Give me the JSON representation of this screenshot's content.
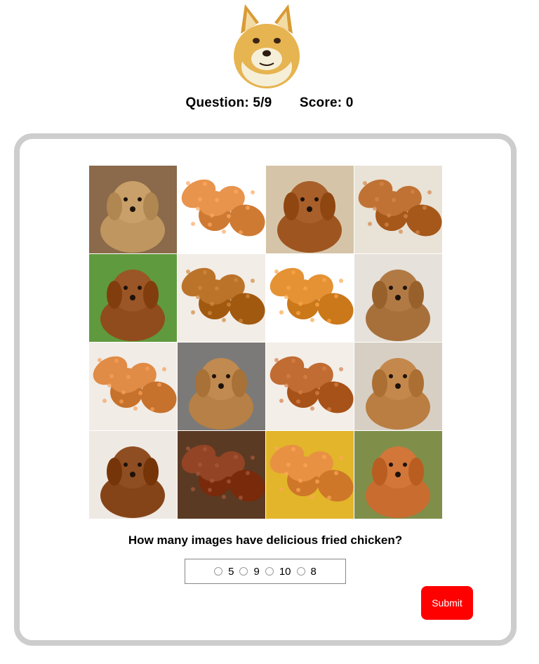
{
  "status": {
    "question": "Question: 5/9",
    "score": "Score: 0"
  },
  "logo_icon": "doge-dog-logo-icon",
  "quiz": {
    "prompt": "How many images have delicious fried chicken?",
    "options": [
      "5",
      "9",
      "10",
      "8"
    ],
    "submit_label": "Submit"
  },
  "grid_tiles": [
    {
      "subject": "dog",
      "fur": "#c9a06a"
    },
    {
      "subject": "chicken",
      "fur": "#e08c45"
    },
    {
      "subject": "dog",
      "fur": "#a85f2a"
    },
    {
      "subject": "chicken",
      "fur": "#b86a2c"
    },
    {
      "subject": "dog",
      "fur": "#9a5626"
    },
    {
      "subject": "chicken",
      "fur": "#b36b22"
    },
    {
      "subject": "chicken",
      "fur": "#dd8a2c"
    },
    {
      "subject": "dog",
      "fur": "#b17a45"
    },
    {
      "subject": "chicken",
      "fur": "#d8833e"
    },
    {
      "subject": "dog",
      "fur": "#c08a50"
    },
    {
      "subject": "chicken",
      "fur": "#b9642a"
    },
    {
      "subject": "dog",
      "fur": "#c4884c"
    },
    {
      "subject": "dog",
      "fur": "#8f4e22"
    },
    {
      "subject": "chicken",
      "fur": "#8a3c1c"
    },
    {
      "subject": "chicken",
      "fur": "#e0893a"
    },
    {
      "subject": "dog",
      "fur": "#d2763a"
    }
  ],
  "colors": {
    "submit": "#ff0000",
    "card_border": "#cdcdcd"
  }
}
